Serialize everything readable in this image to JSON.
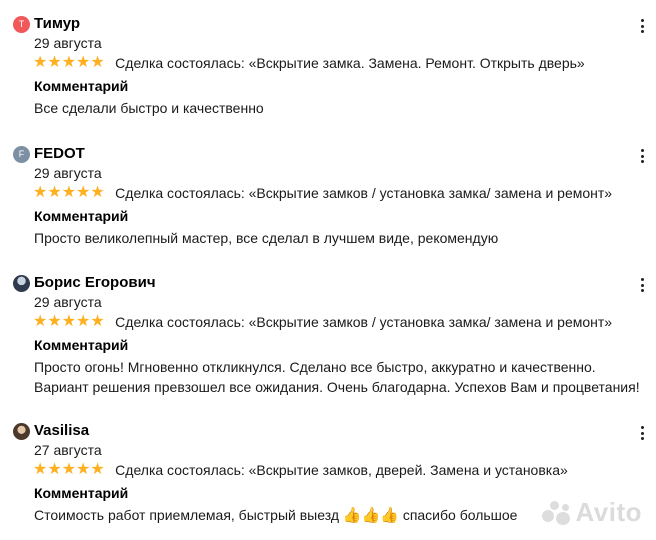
{
  "reviews": [
    {
      "avatar_letter": "T",
      "avatar_color": "#f0585a",
      "name": "Тимур",
      "date": "29 августа",
      "stars": "★★★★★",
      "deal": "Сделка состоялась: «Вскрытие замка. Замена. Ремонт. Открыть дверь»",
      "comment_label": "Комментарий",
      "comment": "Все сделали быстро и качественно"
    },
    {
      "avatar_letter": "F",
      "avatar_color": "#7d8fa3",
      "name": "FEDOT",
      "date": "29 августа",
      "stars": "★★★★★",
      "deal": "Сделка состоялась: «Вскрытие замков / установка замка/ замена и ремонт»",
      "comment_label": "Комментарий",
      "comment": "Просто великолепный мастер, все сделал в лучшем виде, рекомендую"
    },
    {
      "name": "Борис Егорович",
      "date": "29 августа",
      "stars": "★★★★★",
      "deal": "Сделка состоялась: «Вскрытие замков / установка замка/ замена и ремонт»",
      "comment_label": "Комментарий",
      "comment_line1": "Просто огонь! Мгновенно откликнулся. Сделано все быстро, аккуратно и качественно.",
      "comment_line2": "Вариант решения превзошел все ожидания. Очень благодарна. Успехов Вам и процветания!"
    },
    {
      "name": "Vasilisa",
      "date": "27 августа",
      "stars": "★★★★★",
      "deal": "Сделка состоялась: «Вскрытие замков, дверей. Замена и установка»",
      "comment_label": "Комментарий",
      "comment_before": "Стоимость работ приемлемая, быстрый выезд",
      "thumbs": "👍👍👍",
      "comment_after": "спасибо большое"
    }
  ],
  "watermark": "Avito",
  "colors": {
    "star": "#ffb021",
    "text": "#1a1a1a"
  },
  "icons": {
    "more": "more-vertical-icon"
  }
}
